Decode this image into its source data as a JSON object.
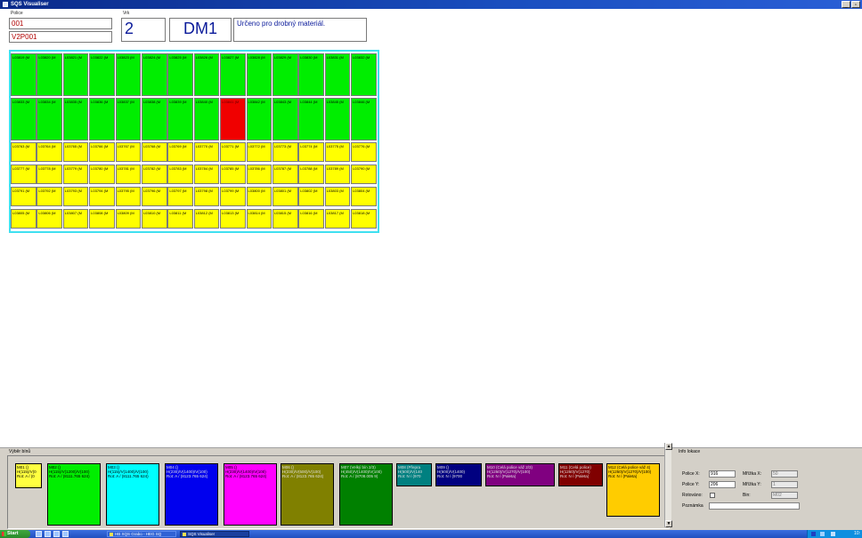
{
  "window": {
    "title": "SQS Visualiser"
  },
  "header": {
    "police_label": "Police",
    "police_value_1": "001",
    "police_value_2": "V2P001",
    "vrk_label": "Vrk",
    "vrk_value": "2",
    "dm_value": "DM1",
    "description": "Určeno pro drobný materiál."
  },
  "grid": {
    "rows": [
      {
        "color": "green",
        "cells": [
          "L03819 (M",
          "L03820 (M",
          "L03821 (M",
          "L03822 (M",
          "L03823 (M",
          "L03824 (M",
          "L03825 (M",
          "L03826 (M",
          "L03827 (M",
          "L03828 (M",
          "L03829 (M",
          "L03830 (M",
          "L03831 (M",
          "L03832 (M"
        ]
      },
      {
        "color": "green",
        "red_index": 8,
        "cells": [
          "L03833 (M",
          "L03834 (M",
          "L03835 (M",
          "L03836 (M",
          "L03837 (M",
          "L03838 (M",
          "L03839 (M",
          "L03840 (M",
          "L03841 (M",
          "L03842 (M",
          "L03843 (M",
          "L03844 (M",
          "L03845 (M",
          "L03846 (M"
        ]
      },
      {
        "color": "yellow",
        "cells": [
          "L03763 (M",
          "L03764 (M",
          "L03765 (M",
          "L03766 (M",
          "L03767 (M",
          "L03768 (M",
          "L03769 (M",
          "L03770 (M",
          "L03771 (M",
          "L03772 (M",
          "L03773 (M",
          "L03774 (M",
          "L03775 (M",
          "L03776 (M"
        ]
      },
      {
        "color": "yellow",
        "cells": [
          "L03777 (M",
          "L03778 (M",
          "L03779 (M",
          "L03780 (M",
          "L03781 (M",
          "L03782 (M",
          "L03783 (M",
          "L03784 (M",
          "L03785 (M",
          "L03786 (M",
          "L03787 (M",
          "L03788 (M",
          "L03789 (M",
          "L03790 (M"
        ]
      },
      {
        "color": "yellow",
        "cells": [
          "L03791 (M",
          "L03792 (M",
          "L03793 (M",
          "L03794 (M",
          "L03795 (M",
          "L03796 (M",
          "L03797 (M",
          "L03798 (M",
          "L03799 (M",
          "L03800 (M",
          "L03801 (M",
          "L03802 (M",
          "L03803 (M",
          "L03804 (M"
        ]
      },
      {
        "color": "yellow",
        "cells": [
          "L03805 (M",
          "L03806 (M",
          "L03807 (M",
          "L03808 (M",
          "L03809 (M",
          "L03810 (M",
          "L03811 (M",
          "L03812 (M",
          "L03813 (M",
          "L03814 (M",
          "L03815 (M",
          "L03816 (M",
          "L03817 (M",
          "L03818 (M"
        ]
      }
    ]
  },
  "bins_panel": {
    "label": "Výběr bínů",
    "bins": [
      {
        "color": "#ffff40",
        "lines": [
          "M01 ()",
          "H(115)/V(0",
          "Rot: A / (0"
        ]
      },
      {
        "color": "#00ee00",
        "lines": [
          "M02 ()",
          "H(115)/V(1200)/V(100)",
          "Rot: A / (8111.765 624)"
        ]
      },
      {
        "color": "#00ffff",
        "lines": [
          "M03 ()",
          "H(115)/V(1400)/V(100)",
          "Rot: A / (8111.765 624)"
        ]
      },
      {
        "color": "#0000ee",
        "lines": [
          "M04 ()",
          "H(230)/V(1400)/V(100)",
          "Rot: A / (8123.765 624)"
        ]
      },
      {
        "color": "#ff00ff",
        "lines": [
          "M05 ()",
          "H(230)/V(1400)/V(100)",
          "Rot: A / (8123.765 624)"
        ]
      },
      {
        "color": "#808000",
        "lines": [
          "M06 ()",
          "H(230)/V(500)/V(100)",
          "Rot: A / (8123.765 624)"
        ]
      },
      {
        "color": "#008000",
        "lines": [
          "M07 (Velký bín 2/3)",
          "H(450)/V(1400)/V(100)",
          "Rot: A / (8708.005 9)"
        ]
      },
      {
        "color": "#008080",
        "lines": [
          "M08 (Přepra",
          "H(600)/V(140",
          "Rot: N / (970"
        ]
      },
      {
        "color": "#000080",
        "lines": [
          "M09 ()",
          "H(600)/V(1400)",
          "Rot: N / (9700"
        ]
      },
      {
        "color": "#800080",
        "lines": [
          "M10 (Celá police váž 2/3)",
          "H(1250)/V(1270)/V(100)",
          "Rot: N / (Paleta)"
        ]
      },
      {
        "color": "#800000",
        "lines": [
          "M11 (Celá police)",
          "H(1250)/V(1270)",
          "Rot: N / (Paleta)"
        ]
      },
      {
        "color": "#ffcc00",
        "lines": [
          "M12 (Celá police váž 4)",
          "H(1250)/V(1270)/V(100)",
          "Rot: N / (Paleta)"
        ]
      }
    ]
  },
  "info_panel": {
    "label": "Info lokace",
    "police_x_label": "Police X:",
    "police_x_value": "916",
    "police_y_label": "Police Y:",
    "police_y_value": "206",
    "rotovano_label": "Rotováno:",
    "poznamka_label": "Poznámka",
    "poznamka_value": "",
    "mrizka_x_label": "Mřížka X:",
    "mrizka_x_value": "50",
    "mrizka_y_label": "Mřížka Y:",
    "mrizka_y_value": "1",
    "bin_label": "Bin:",
    "bin_value": "M02"
  },
  "taskbar": {
    "start_label": "Start",
    "tasks": [
      "HB XQS Grabo - HEG SQ",
      "SQS Visualiser"
    ],
    "clock": "10:"
  }
}
